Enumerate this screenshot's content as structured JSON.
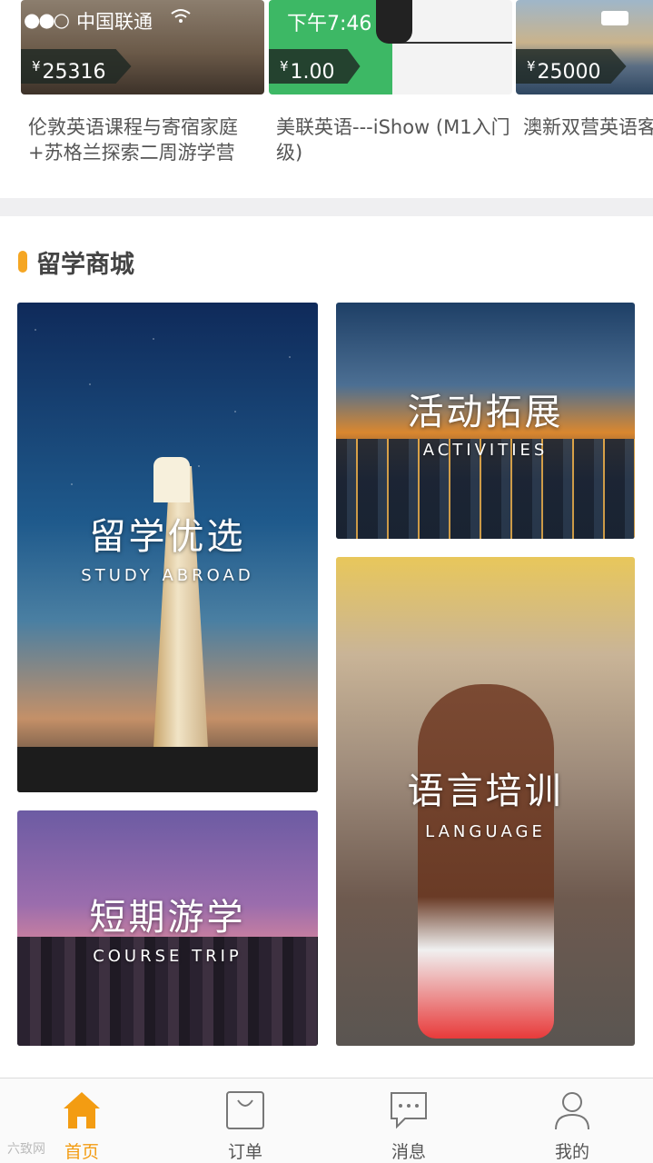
{
  "status_bar": {
    "carrier": "中国联通",
    "time": "下午7:46"
  },
  "products": [
    {
      "price": "25316",
      "title": "伦敦英语课程与寄宿家庭+苏格兰探索二周游学营"
    },
    {
      "price": "1.00",
      "title": "美联英语---iShow (M1入门级)"
    },
    {
      "price": "25000",
      "title": "澳新双营英语客旅"
    }
  ],
  "currency_symbol": "¥",
  "section": {
    "title": "留学商城",
    "accent_color": "#f5a623"
  },
  "tiles": {
    "study": {
      "zh": "留学优选",
      "en": "STUDY ABROAD"
    },
    "activities": {
      "zh": "活动拓展",
      "en": "ACTIVITIES"
    },
    "language": {
      "zh": "语言培训",
      "en": "LANGUAGE"
    },
    "trip": {
      "zh": "短期游学",
      "en": "COURSE TRIP"
    }
  },
  "tabbar": {
    "active_color": "#f39c12",
    "tabs": [
      {
        "label": "首页",
        "icon": "home-icon",
        "active": true
      },
      {
        "label": "订单",
        "icon": "shopping-bag-icon",
        "active": false
      },
      {
        "label": "消息",
        "icon": "message-icon",
        "active": false
      },
      {
        "label": "我的",
        "icon": "user-icon",
        "active": false
      }
    ]
  },
  "watermark": "六致网"
}
